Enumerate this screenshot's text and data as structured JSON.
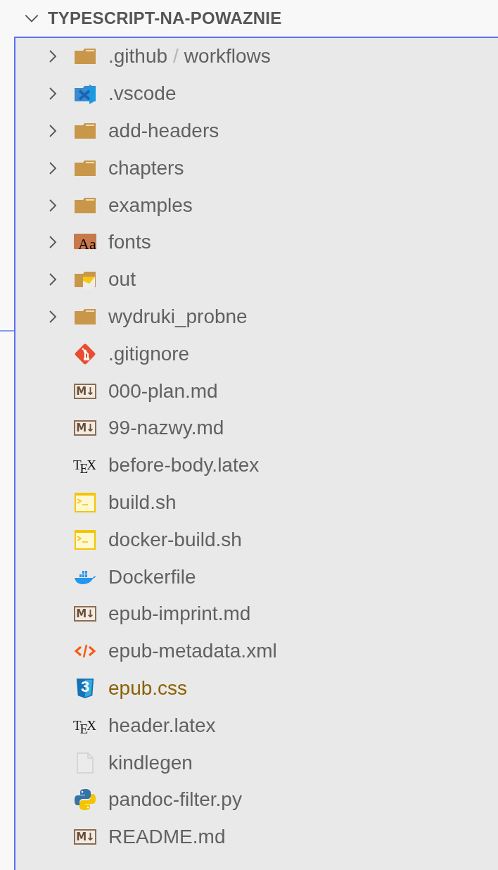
{
  "explorer": {
    "title": "TYPESCRIPT-NA-POWAZNIE",
    "expanded": true
  },
  "items": [
    {
      "kind": "folder",
      "name_parts": [
        ".github",
        "workflows"
      ],
      "separator": "/",
      "expanded": false
    },
    {
      "kind": "code-folder",
      "name": ".vscode",
      "expanded": false
    },
    {
      "kind": "folder",
      "name": "add-headers",
      "expanded": false
    },
    {
      "kind": "folder",
      "name": "chapters",
      "expanded": false
    },
    {
      "kind": "folder",
      "name": "examples",
      "expanded": false
    },
    {
      "kind": "font-folder",
      "icon_text": "Aa",
      "name": "fonts",
      "expanded": false
    },
    {
      "kind": "output-folder",
      "name": "out",
      "expanded": false
    },
    {
      "kind": "folder",
      "name": "wydruki_probne",
      "expanded": false
    },
    {
      "kind": "git",
      "name": ".gitignore",
      "modified": false
    },
    {
      "kind": "markdown",
      "icon_text": "M↓",
      "name": "000-plan.md",
      "modified": false
    },
    {
      "kind": "markdown",
      "icon_text": "M↓",
      "name": "99-nazwy.md",
      "modified": false
    },
    {
      "kind": "tex",
      "icon_text": "T$_{E}$X",
      "name": "before-body.latex",
      "modified": false
    },
    {
      "kind": "shell",
      "name": "build.sh",
      "modified": false
    },
    {
      "kind": "shell",
      "name": "docker-build.sh",
      "modified": false
    },
    {
      "kind": "docker",
      "name": "Dockerfile",
      "modified": false
    },
    {
      "kind": "markdown",
      "icon_text": "M↓",
      "name": "epub-imprint.md",
      "modified": false
    },
    {
      "kind": "xml",
      "name": "epub-metadata.xml",
      "modified": false
    },
    {
      "kind": "css",
      "icon_text": "3",
      "name": "epub.css",
      "modified": true
    },
    {
      "kind": "tex",
      "icon_text": "T$_{E}$X",
      "name": "header.latex",
      "modified": false
    },
    {
      "kind": "plain",
      "name": "kindlegen",
      "modified": false
    },
    {
      "kind": "python",
      "name": "pandoc-filter.py",
      "modified": false
    },
    {
      "kind": "markdown",
      "icon_text": "M↓",
      "name": "README.md",
      "modified": false
    }
  ]
}
